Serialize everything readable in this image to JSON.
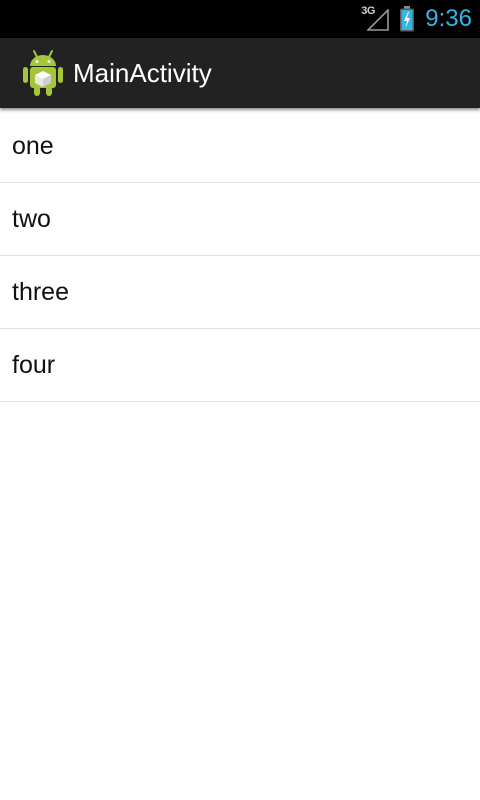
{
  "status_bar": {
    "network_type": "3G",
    "signal_icon": "signal-icon",
    "battery_icon": "battery-charging-icon",
    "time": "9:36",
    "clock_color": "#33b5e5"
  },
  "action_bar": {
    "app_icon": "android-robot-icon",
    "title": "MainActivity",
    "background": "#222222"
  },
  "list": {
    "items": [
      {
        "label": "one"
      },
      {
        "label": "two"
      },
      {
        "label": "three"
      },
      {
        "label": "four"
      }
    ]
  }
}
